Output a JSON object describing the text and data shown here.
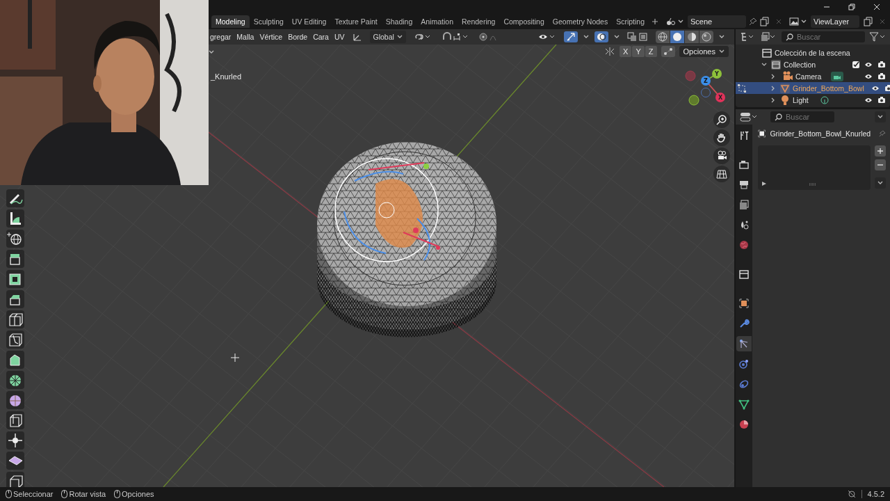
{
  "workspace_tabs": [
    {
      "label": "Modeling",
      "selected": true
    },
    {
      "label": "Sculpting",
      "selected": false
    },
    {
      "label": "UV Editing",
      "selected": false
    },
    {
      "label": "Texture Paint",
      "selected": false
    },
    {
      "label": "Shading",
      "selected": false
    },
    {
      "label": "Animation",
      "selected": false
    },
    {
      "label": "Rendering",
      "selected": false
    },
    {
      "label": "Compositing",
      "selected": false
    },
    {
      "label": "Geometry Nodes",
      "selected": false
    },
    {
      "label": "Scripting",
      "selected": false
    }
  ],
  "scene": {
    "label": "Scene"
  },
  "view_layer": {
    "label": "ViewLayer"
  },
  "viewport_header": {
    "menus": [
      "gregar",
      "Malla",
      "Vértice",
      "Borde",
      "Cara",
      "UV"
    ],
    "orientation": "Global",
    "gizmos_on": true,
    "overlays_on": true,
    "shading": [
      {
        "kind": "wireframe",
        "selected": false
      },
      {
        "kind": "solid",
        "selected": true
      },
      {
        "kind": "material",
        "selected": false
      },
      {
        "kind": "rendered",
        "selected": false
      }
    ]
  },
  "viewport": {
    "object_label": "_Knurled",
    "mirror_axes": [
      "X",
      "Y",
      "Z"
    ],
    "options": "Opciones",
    "gizmo": {
      "x": "X",
      "y": "Y",
      "z": "Z"
    }
  },
  "outliner": {
    "search_placeholder": "Buscar",
    "tree": [
      {
        "label": "Colección de la escena",
        "kind": "scene_collection",
        "children": [
          {
            "label": "Collection",
            "kind": "collection",
            "expanded": true,
            "checked": true,
            "children": [
              {
                "label": "Camera",
                "kind": "camera",
                "expanded": false,
                "selected": false
              },
              {
                "label": "Grinder_Bottom_Bowl",
                "kind": "mesh",
                "expanded": false,
                "selected": true
              },
              {
                "label": "Light",
                "kind": "light",
                "expanded": false,
                "selected": false
              }
            ]
          }
        ]
      }
    ]
  },
  "properties": {
    "search_placeholder": "Buscar",
    "object_name": "Grinder_Bottom_Bowl_Knurled",
    "tabs": [
      {
        "kind": "tool",
        "selected": false
      },
      {
        "kind": "render",
        "selected": false
      },
      {
        "kind": "output",
        "selected": false
      },
      {
        "kind": "view_layer",
        "selected": false
      },
      {
        "kind": "scene",
        "selected": false
      },
      {
        "kind": "world",
        "selected": false
      },
      {
        "kind": "collection",
        "selected": false
      },
      {
        "kind": "object",
        "selected": false
      },
      {
        "kind": "modifier",
        "selected": false
      },
      {
        "kind": "particles",
        "selected": true
      },
      {
        "kind": "physics",
        "selected": false
      },
      {
        "kind": "constraints",
        "selected": false
      },
      {
        "kind": "data",
        "selected": false
      },
      {
        "kind": "material",
        "selected": false
      }
    ]
  },
  "status_bar": {
    "hints": [
      "Seleccionar",
      "Rotar vista",
      "Opciones"
    ],
    "version": "4.5.2"
  }
}
